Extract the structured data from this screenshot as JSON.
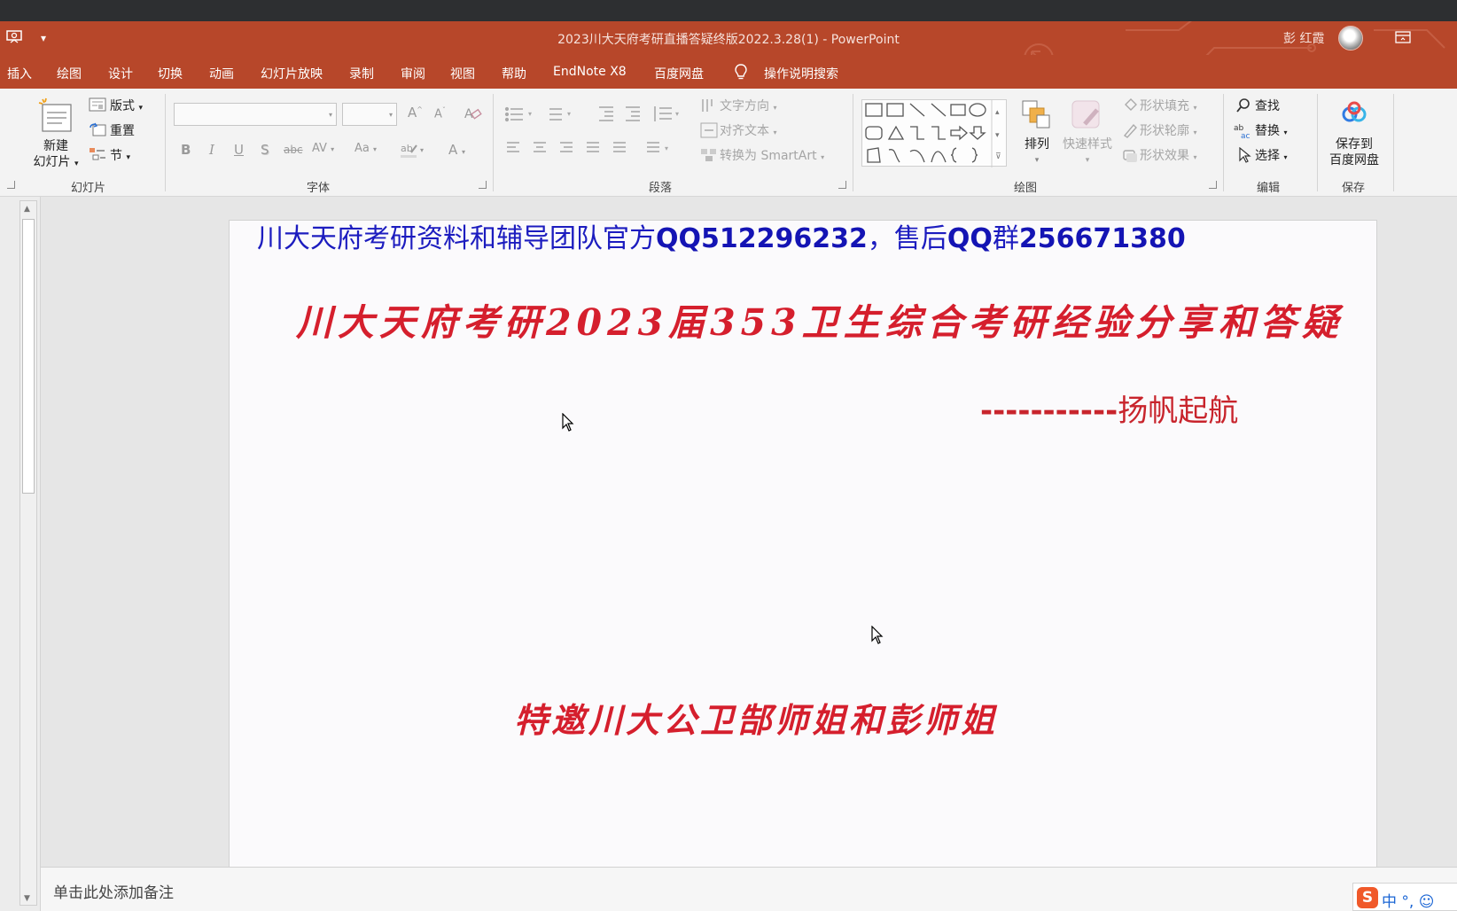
{
  "window": {
    "title": "2023川大天府考研直播答疑终版2022.3.28(1)  -  PowerPoint",
    "user": "彭 红霞"
  },
  "menu": {
    "tabs": [
      "插入",
      "绘图",
      "设计",
      "切换",
      "动画",
      "幻灯片放映",
      "录制",
      "审阅",
      "视图",
      "帮助",
      "EndNote X8",
      "百度网盘"
    ],
    "tell_me": "操作说明搜索"
  },
  "ribbon": {
    "slides_group": {
      "label": "幻灯片",
      "new_slide_line1": "新建",
      "new_slide_line2": "幻灯片",
      "layout": "版式",
      "reset": "重置",
      "section": "节"
    },
    "font_group": {
      "label": "字体",
      "bold": "B",
      "italic": "I",
      "underline": "U",
      "shadow": "S",
      "strike": "abc",
      "spacing": "AV",
      "case": "Aa",
      "color": "A",
      "grow": "A",
      "shrink": "A"
    },
    "paragraph_group": {
      "label": "段落",
      "text_direction": "文字方向",
      "align_text": "对齐文本",
      "smartart": "转换为 SmartArt"
    },
    "drawing_group": {
      "label": "绘图",
      "arrange": "排列",
      "quick_styles": "快速样式",
      "shape_fill": "形状填充",
      "shape_outline": "形状轮廓",
      "shape_effects": "形状效果"
    },
    "editing_group": {
      "label": "编辑",
      "find": "查找",
      "replace": "替换",
      "select": "选择"
    },
    "save_group": {
      "label": "保存",
      "save_line1": "保存到",
      "save_line2": "百度网盘"
    }
  },
  "slide": {
    "line1_a": "川大天府考研资料和辅导团队官方",
    "line1_b": "QQ512296232",
    "line1_c": "，售后",
    "line1_d": "QQ",
    "line1_e": "群",
    "line1_f": "256671380",
    "title": "川大天府考研2023届353卫生综合考研经验分享和答疑",
    "dash": "-----------",
    "presenter": "扬帆起航",
    "guests": "特邀川大公卫郜师姐和彭师姐"
  },
  "notes": {
    "placeholder": "单击此处添加备注"
  },
  "ime": {
    "logo": "S",
    "text": "中 °, ☺"
  },
  "colors": {
    "accent": "#b7472a",
    "slide_blue": "#1c1cbf",
    "slide_red": "#d51f2d"
  }
}
